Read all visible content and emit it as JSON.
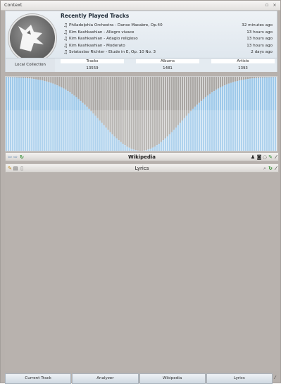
{
  "window": {
    "title": "Context",
    "btn_float": "▫",
    "btn_close": "×"
  },
  "current_track": {
    "recent_title": "Recently Played Tracks",
    "tracks": [
      {
        "name": "Philadelphia Orchestra - Danse Macabre, Op.40",
        "time": "32 minutes ago"
      },
      {
        "name": "Kim Kashkashian - Allegro vivace",
        "time": "13 hours ago"
      },
      {
        "name": "Kim Kashkashian - Adagio religioso",
        "time": "13 hours ago"
      },
      {
        "name": "Kim Kashkashian - Moderato",
        "time": "13 hours ago"
      },
      {
        "name": "Sviatoslav Richter - Etude in E, Op. 10 No. 3",
        "time": "2 days ago"
      }
    ],
    "local_collection": "Local Collection",
    "stats": {
      "tracks_label": "Tracks",
      "tracks_value": "13559",
      "albums_label": "Albums",
      "albums_value": "1481",
      "artists_label": "Artists",
      "artists_value": "1393"
    }
  },
  "analyzer": {
    "bar_color": "#9ec9ea",
    "peak_color": "#a9a6a3"
  },
  "wikipedia": {
    "title": "Wikipedia",
    "back_icon": "back-icon",
    "forward_icon": "forward-icon",
    "reload_icon": "reload-icon"
  },
  "lyrics": {
    "title": "Lyrics"
  },
  "tabs": [
    {
      "label": "Current Track"
    },
    {
      "label": "Analyzer"
    },
    {
      "label": "Wikipedia"
    },
    {
      "label": "Lyrics"
    }
  ]
}
